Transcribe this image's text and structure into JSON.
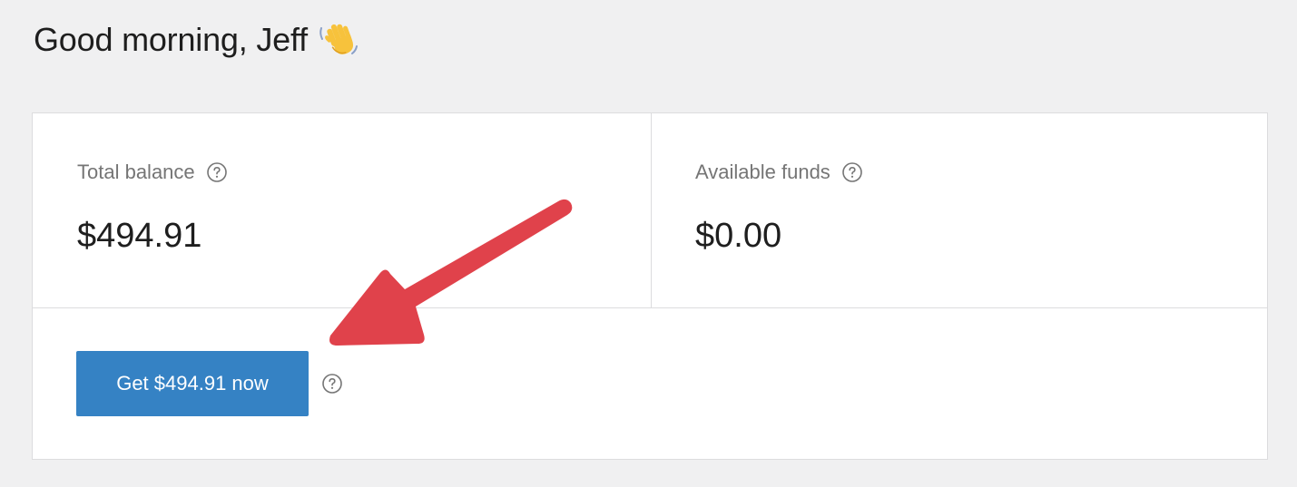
{
  "greeting": {
    "text": "Good morning, Jeff",
    "emoji_icon": "waving-hand-icon"
  },
  "stats": [
    {
      "label": "Total balance",
      "value": "$494.91",
      "help_icon": "question-circle-icon"
    },
    {
      "label": "Available funds",
      "value": "$0.00",
      "help_icon": "question-circle-icon"
    }
  ],
  "action": {
    "button_label": "Get $494.91 now",
    "help_icon": "question-circle-icon"
  },
  "annotation": {
    "arrow_color": "#e0424b",
    "icon": "red-arrow-icon"
  },
  "colors": {
    "background": "#f0f0f1",
    "card": "#ffffff",
    "border": "#dcdcde",
    "primary": "#3582c4",
    "label": "#757575",
    "text": "#1e1e1e"
  }
}
